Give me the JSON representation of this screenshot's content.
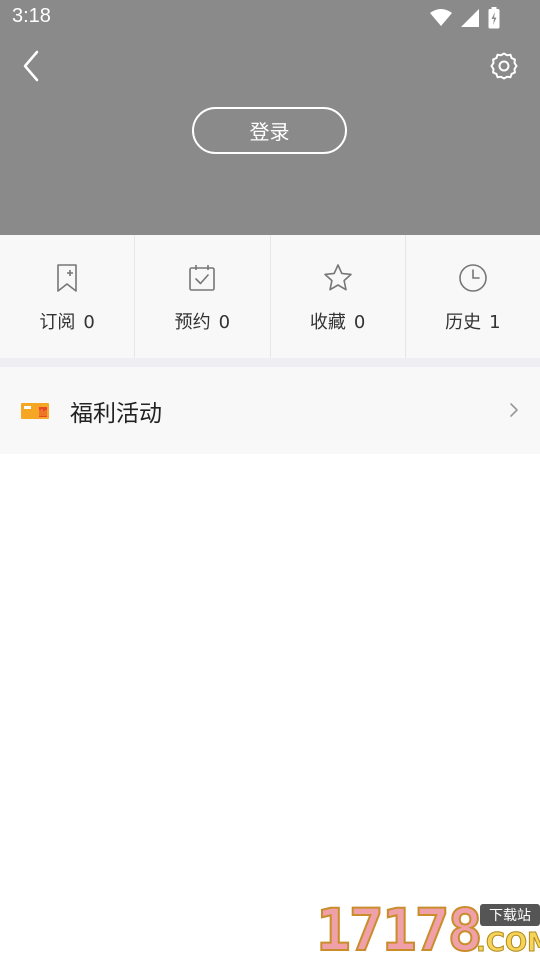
{
  "status_bar": {
    "time": "3:18",
    "icons": [
      "wifi-icon",
      "signal-icon",
      "battery-charging-icon"
    ]
  },
  "header": {
    "background": "#8a8a8a",
    "back_icon": "chevron-left-icon",
    "settings_icon": "gear-icon",
    "login_label": "登录"
  },
  "stats": [
    {
      "label": "订阅",
      "count": "0",
      "icon": "bookmark-plus-icon"
    },
    {
      "label": "预约",
      "count": "0",
      "icon": "calendar-check-icon"
    },
    {
      "label": "收藏",
      "count": "0",
      "icon": "star-icon"
    },
    {
      "label": "历史",
      "count": "1",
      "icon": "clock-icon"
    }
  ],
  "menu": [
    {
      "label": "福利活动",
      "icon": "coupon-icon",
      "icon_color": "#f5a623"
    }
  ],
  "watermark": {
    "digits": "17178",
    "tag": "下载站",
    "domain": ".COM"
  }
}
